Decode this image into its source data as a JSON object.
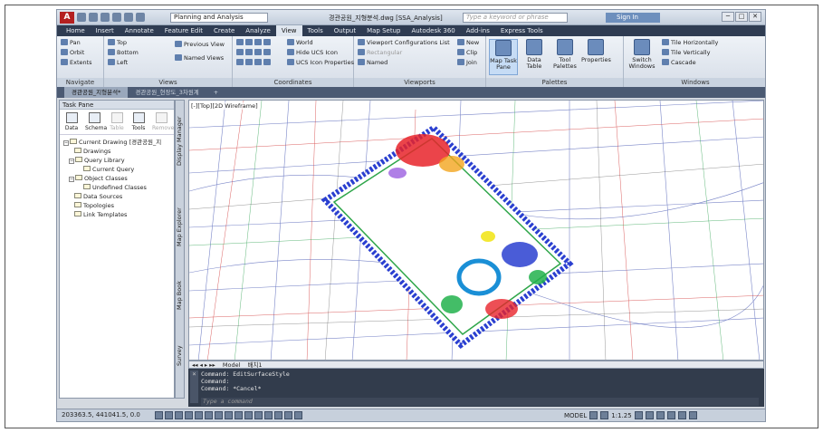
{
  "app": {
    "logo": "A",
    "workspace": "Planning and Analysis",
    "file_title": "경관공원_지형분석.dwg [SSA_Analysis]",
    "search_placeholder": "Type a keyword or phrase",
    "signin": "Sign In",
    "win_min": "─",
    "win_max": "□",
    "win_close": "✕"
  },
  "ribbon_tabs": [
    "Home",
    "Insert",
    "Annotate",
    "Feature Edit",
    "Create",
    "Analyze",
    "View",
    "Tools",
    "Output",
    "Map Setup",
    "Autodesk 360",
    "Add-ins",
    "Express Tools"
  ],
  "active_tab": "View",
  "ribbon": {
    "navigate": {
      "title": "Navigate",
      "pan": "Pan",
      "orbit": "Orbit",
      "extents": "Extents"
    },
    "views": {
      "title": "Views",
      "top": "Top",
      "bottom": "Bottom",
      "left": "Left",
      "previous": "Previous View",
      "named": "Named Views"
    },
    "coordinates": {
      "title": "Coordinates",
      "world": "World",
      "hide_ucs": "Hide UCS Icon",
      "ucs_props": "UCS Icon Properties"
    },
    "viewports": {
      "title": "Viewports",
      "config": "Viewport Configurations List",
      "rectangular": "Rectangular",
      "named": "Named",
      "new": "New",
      "clip": "Clip",
      "join": "Join"
    },
    "palettes": {
      "title": "Palettes",
      "map_task_pane": "Map Task Pane",
      "data_table": "Data Table",
      "tool_palettes": "Tool Palettes",
      "properties": "Properties"
    },
    "windows": {
      "title": "Windows",
      "switch": "Switch Windows",
      "tile_h": "Tile Horizontally",
      "tile_v": "Tile Vertically",
      "cascade": "Cascade"
    }
  },
  "doc_tabs": [
    "경관공원_지형분석*",
    "경관공원_현장도_3차원계"
  ],
  "task_pane": {
    "title": "Task Pane",
    "tools": [
      "Data",
      "Schema",
      "Table",
      "Tools",
      "Remove"
    ],
    "tree": [
      "Current Drawing [경관공원_지",
      "Drawings",
      "Query Library",
      "Current Query",
      "Object Classes",
      "Undefined Classes",
      "Data Sources",
      "Topologies",
      "Link Templates"
    ]
  },
  "vertical_tabs": [
    "Display Manager",
    "Map Explorer",
    "Map Book",
    "Survey"
  ],
  "viewport_label": "[-][Top][2D Wireframe]",
  "layout_tabs": [
    "Model",
    "배치1"
  ],
  "command_lines": [
    "Command: EditSurfaceStyle",
    "Command:",
    "Command: *Cancel*"
  ],
  "command_placeholder": "Type a command",
  "status": {
    "coords": "203363.5, 441041.5, 0.0",
    "model": "MODEL",
    "scale": "1:1.25"
  }
}
